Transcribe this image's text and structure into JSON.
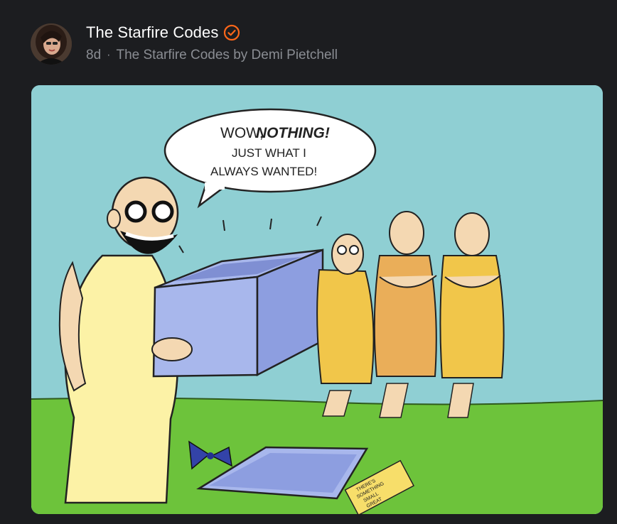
{
  "post": {
    "author": "The Starfire Codes",
    "age": "8d",
    "separator": "·",
    "publication": "The Starfire Codes by Demi Pietchell"
  },
  "icons": {
    "verified": "verified-check-icon",
    "avatar": "author-avatar"
  },
  "colors": {
    "background": "#1c1d20",
    "verified": "#ff6719",
    "title": "#ffffff",
    "meta": "#8a8d93"
  },
  "comic": {
    "speech": {
      "line1a": "WOW,",
      "line1b": "NOTHING!",
      "line2": "JUST WHAT I",
      "line3": "ALWAYS WANTED!"
    },
    "card_text": [
      "THERE'S",
      "SOMETHING",
      "SMALL",
      "GREAT"
    ]
  }
}
